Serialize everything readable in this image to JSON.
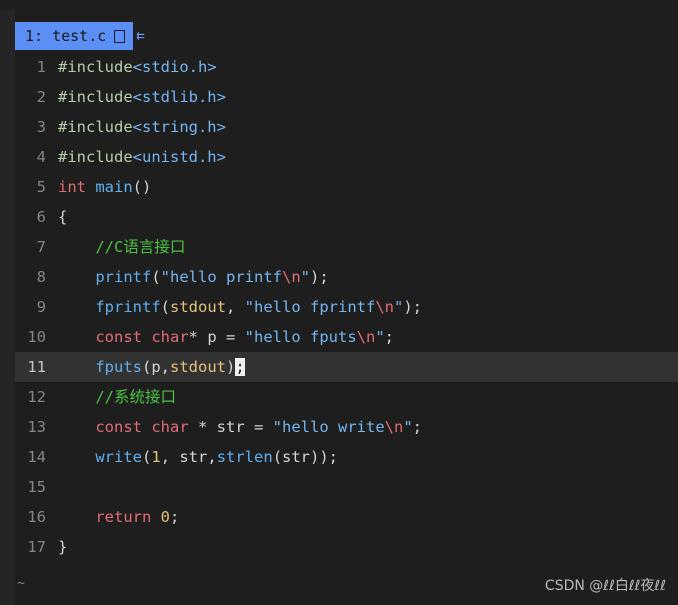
{
  "tab": {
    "label": "1: test.c"
  },
  "lines": [
    {
      "num": "1",
      "parts": [
        [
          "#include",
          "pre"
        ],
        [
          "<stdio.h>",
          "str"
        ]
      ]
    },
    {
      "num": "2",
      "parts": [
        [
          "#include",
          "pre"
        ],
        [
          "<stdlib.h>",
          "str"
        ]
      ]
    },
    {
      "num": "3",
      "parts": [
        [
          "#include",
          "pre"
        ],
        [
          "<string.h>",
          "str"
        ]
      ]
    },
    {
      "num": "4",
      "parts": [
        [
          "#include",
          "pre"
        ],
        [
          "<unistd.h>",
          "str"
        ]
      ]
    },
    {
      "num": "5",
      "parts": [
        [
          "int",
          "kw"
        ],
        [
          " ",
          "p"
        ],
        [
          "main",
          "fn"
        ],
        [
          "()",
          "p"
        ]
      ]
    },
    {
      "num": "6",
      "parts": [
        [
          "{",
          "p"
        ]
      ]
    },
    {
      "num": "7",
      "parts": [
        [
          "    ",
          "p"
        ],
        [
          "//C语言接口",
          "cm"
        ]
      ]
    },
    {
      "num": "8",
      "parts": [
        [
          "    ",
          "p"
        ],
        [
          "printf",
          "fn"
        ],
        [
          "(",
          "p"
        ],
        [
          "\"hello printf",
          "str"
        ],
        [
          "\\n",
          "esc"
        ],
        [
          "\"",
          "str"
        ],
        [
          ");",
          "p"
        ]
      ]
    },
    {
      "num": "9",
      "parts": [
        [
          "    ",
          "p"
        ],
        [
          "fprintf",
          "fn"
        ],
        [
          "(",
          "p"
        ],
        [
          "stdout",
          "var"
        ],
        [
          ", ",
          "p"
        ],
        [
          "\"hello fprintf",
          "str"
        ],
        [
          "\\n",
          "esc"
        ],
        [
          "\"",
          "str"
        ],
        [
          ");",
          "p"
        ]
      ]
    },
    {
      "num": "10",
      "parts": [
        [
          "    ",
          "p"
        ],
        [
          "const",
          "kw"
        ],
        [
          " ",
          "p"
        ],
        [
          "char",
          "kw"
        ],
        [
          "* p = ",
          "p"
        ],
        [
          "\"hello fputs",
          "str"
        ],
        [
          "\\n",
          "esc"
        ],
        [
          "\"",
          "str"
        ],
        [
          ";",
          "p"
        ]
      ]
    },
    {
      "num": "11",
      "cursorline": true,
      "parts": [
        [
          "    ",
          "p"
        ],
        [
          "fputs",
          "fn"
        ],
        [
          "(p,",
          "p"
        ],
        [
          "stdout",
          "var"
        ],
        [
          ")",
          "p"
        ],
        [
          ";",
          "cursor"
        ]
      ]
    },
    {
      "num": "12",
      "parts": [
        [
          "    ",
          "p"
        ],
        [
          "//系统接口",
          "cm"
        ]
      ]
    },
    {
      "num": "13",
      "parts": [
        [
          "    ",
          "p"
        ],
        [
          "const",
          "kw"
        ],
        [
          " ",
          "p"
        ],
        [
          "char",
          "kw"
        ],
        [
          " * str = ",
          "p"
        ],
        [
          "\"hello write",
          "str"
        ],
        [
          "\\n",
          "esc"
        ],
        [
          "\"",
          "str"
        ],
        [
          ";",
          "p"
        ]
      ]
    },
    {
      "num": "14",
      "parts": [
        [
          "    ",
          "p"
        ],
        [
          "write",
          "fn"
        ],
        [
          "(",
          "p"
        ],
        [
          "1",
          "num"
        ],
        [
          ", str,",
          "p"
        ],
        [
          "strlen",
          "fn"
        ],
        [
          "(str));",
          "p"
        ]
      ]
    },
    {
      "num": "15",
      "parts": []
    },
    {
      "num": "16",
      "parts": [
        [
          "    ",
          "p"
        ],
        [
          "return",
          "kw"
        ],
        [
          " ",
          "p"
        ],
        [
          "0",
          "num"
        ],
        [
          ";",
          "p"
        ]
      ]
    },
    {
      "num": "17",
      "parts": [
        [
          "}",
          "p"
        ]
      ]
    }
  ],
  "tilde": "~",
  "watermark": "CSDN @ℓℓ白ℓℓ夜ℓℓ",
  "colors": {
    "background": "#1e1e1e",
    "tab": "#5b8ff5",
    "keyword": "#e06c75",
    "function": "#61afef",
    "comment": "#49c442",
    "string": "#75b5f0"
  }
}
